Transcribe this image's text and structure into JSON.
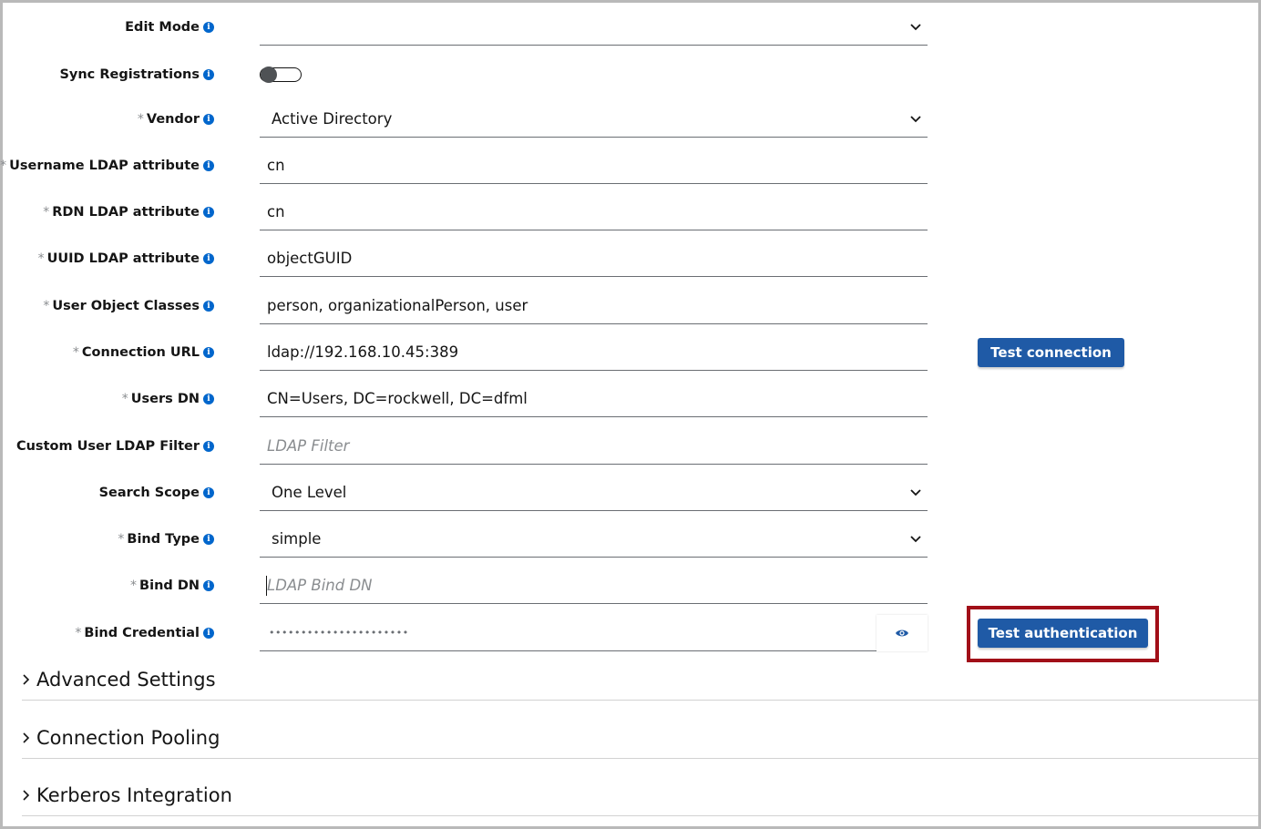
{
  "form": {
    "fields": [
      {
        "label": "Edit Mode",
        "required": false,
        "type": "select",
        "value": ""
      },
      {
        "label": "Sync Registrations",
        "required": false,
        "type": "toggle",
        "value": "off"
      },
      {
        "label": "Vendor",
        "required": true,
        "type": "select",
        "value": "Active Directory"
      },
      {
        "label": "Username LDAP attribute",
        "required": true,
        "type": "text",
        "value": "cn"
      },
      {
        "label": "RDN LDAP attribute",
        "required": true,
        "type": "text",
        "value": "cn"
      },
      {
        "label": "UUID LDAP attribute",
        "required": true,
        "type": "text",
        "value": "objectGUID"
      },
      {
        "label": "User Object Classes",
        "required": true,
        "type": "text",
        "value": "person, organizationalPerson, user"
      },
      {
        "label": "Connection URL",
        "required": true,
        "type": "text",
        "value": "ldap://192.168.10.45:389"
      },
      {
        "label": "Users DN",
        "required": true,
        "type": "text",
        "value": "CN=Users, DC=rockwell, DC=dfml"
      },
      {
        "label": "Custom User LDAP Filter",
        "required": false,
        "type": "text",
        "value": "",
        "placeholder": "LDAP Filter"
      },
      {
        "label": "Search Scope",
        "required": false,
        "type": "select",
        "value": "One Level"
      },
      {
        "label": "Bind Type",
        "required": true,
        "type": "select",
        "value": "simple"
      },
      {
        "label": "Bind DN",
        "required": true,
        "type": "text",
        "value": "",
        "placeholder": "LDAP Bind DN"
      },
      {
        "label": "Bind Credential",
        "required": true,
        "type": "password",
        "value": "••••••••••••••••••••••"
      }
    ],
    "required_mark": "*",
    "info_icon": "i"
  },
  "buttons": {
    "test_connection": "Test connection",
    "test_authentication": "Test authentication"
  },
  "sections": [
    "Advanced Settings",
    "Connection Pooling",
    "Kerberos Integration"
  ],
  "colors": {
    "primary_button": "#1f5aa6",
    "info_icon": "#0066cc",
    "highlight_border": "#a10f18"
  },
  "icons": {
    "info": "info-circle-icon",
    "select": "chevron-down-icon",
    "password_toggle": "eye-icon",
    "section": "chevron-right-icon"
  }
}
